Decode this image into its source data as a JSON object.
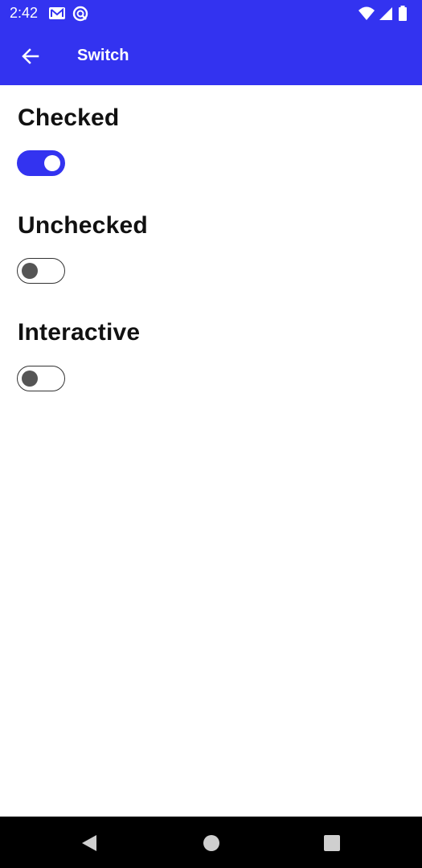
{
  "status_bar": {
    "time": "2:42",
    "icons_left": [
      "mail-icon",
      "sync-icon"
    ],
    "icons_right": [
      "wifi-icon",
      "signal-icon",
      "battery-icon"
    ]
  },
  "app_bar": {
    "title": "Switch",
    "back_icon": "arrow-left-icon",
    "color": "#3333f0"
  },
  "sections": [
    {
      "title": "Checked",
      "checked": true
    },
    {
      "title": "Unchecked",
      "checked": false
    },
    {
      "title": "Interactive",
      "checked": false
    }
  ],
  "nav_bar": {
    "buttons": [
      "back-triangle-icon",
      "home-circle-icon",
      "recents-square-icon"
    ]
  },
  "colors": {
    "accent": "#3333f0",
    "text": "#111111",
    "thumb_off": "#555555"
  }
}
